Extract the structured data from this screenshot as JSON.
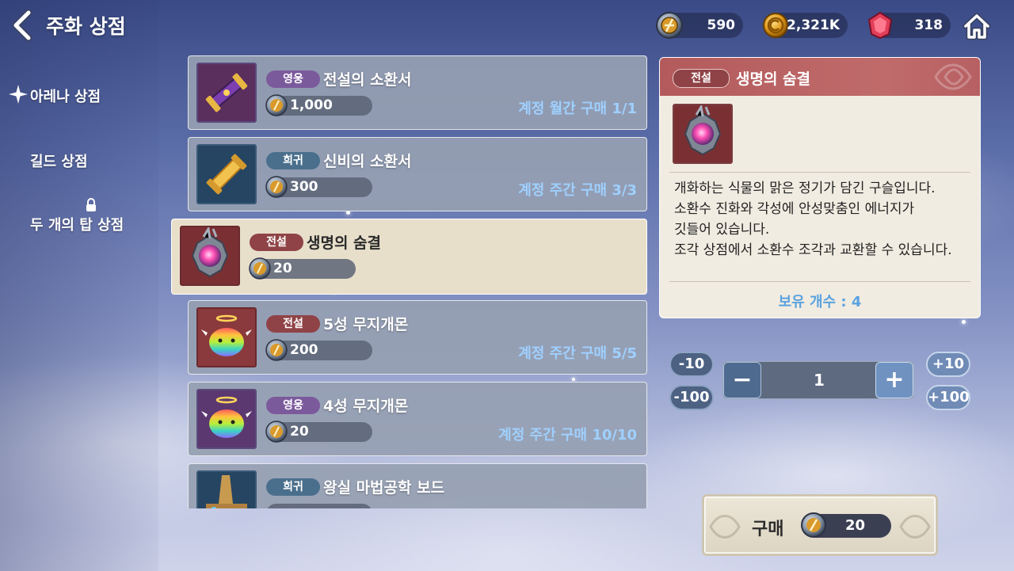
{
  "header": {
    "title": "주화 상점",
    "currencies": [
      {
        "icon": "arena-coin-icon",
        "value": "590"
      },
      {
        "icon": "gold-coin-icon",
        "value": "2,321K"
      },
      {
        "icon": "red-gem-icon",
        "value": "318"
      }
    ]
  },
  "sidebar": {
    "items": [
      {
        "label": "아레나 상점",
        "active": true
      },
      {
        "label": "길드 상점",
        "active": false
      },
      {
        "label": "두 개의 탑 상점",
        "active": false,
        "locked": true
      }
    ]
  },
  "list": {
    "items": [
      {
        "grade": "영웅",
        "name": "전설의 소환서",
        "price": "1,000",
        "limit": "계정 월간 구매 1/1",
        "icon": "purple-scroll-icon"
      },
      {
        "grade": "희귀",
        "name": "신비의 소환서",
        "price": "300",
        "limit": "계정 주간 구매 3/3",
        "icon": "gold-scroll-icon"
      },
      {
        "grade": "전설",
        "name": "생명의 숨결",
        "price": "20",
        "limit": "",
        "icon": "life-breath-orb-icon",
        "selected": true
      },
      {
        "grade": "전설",
        "name": "5성 무지개몬",
        "price": "200",
        "limit": "계정 주간 구매 5/5",
        "icon": "rainbow-slime-icon"
      },
      {
        "grade": "영웅",
        "name": "4성 무지개몬",
        "price": "20",
        "limit": "계정 주간 구매 10/10",
        "icon": "rainbow-slime-icon"
      },
      {
        "grade": "희귀",
        "name": "왕실 마법공학 보드",
        "price": "",
        "limit": "",
        "icon": "magic-board-icon"
      }
    ]
  },
  "detail": {
    "grade": "전설",
    "name": "생명의 숨결",
    "description": [
      "개화하는 식물의 맑은 정기가 담긴 구슬입니다.",
      "소환수 진화와 각성에 안성맞춤인 에너지가",
      "깃들어 있습니다.",
      "조각 상점에서 소환수 조각과 교환할 수 있습니다."
    ],
    "owned": "보유 개수 : 4"
  },
  "quantity": {
    "minus10": "-10",
    "minus100": "-100",
    "plus10": "+10",
    "plus100": "+100",
    "minus": "−",
    "plus": "+",
    "value": "1"
  },
  "buy": {
    "label": "구매",
    "price": "20"
  },
  "colors": {
    "hero": "#7b5a9c",
    "rare": "#4a6f8c",
    "legend": "#8f4346",
    "limit_text": "#9fd0ff",
    "owned_text": "#5aa3e0"
  }
}
